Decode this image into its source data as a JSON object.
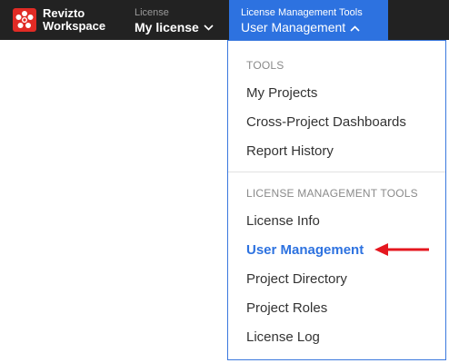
{
  "brand": {
    "line1": "Revizto",
    "line2": "Workspace"
  },
  "license_switcher": {
    "label": "License",
    "value": "My license"
  },
  "tools_tab": {
    "label": "License Management Tools",
    "value": "User Management"
  },
  "dropdown": {
    "sections": [
      {
        "title": "TOOLS",
        "items": [
          "My Projects",
          "Cross-Project Dashboards",
          "Report History"
        ]
      },
      {
        "title": "LICENSE MANAGEMENT TOOLS",
        "items": [
          "License Info",
          "User Management",
          "Project Directory",
          "Project Roles",
          "License Log"
        ]
      }
    ],
    "active_item": "User Management"
  },
  "colors": {
    "topbar": "#222222",
    "accent": "#2d72e0",
    "logo": "#e12b25",
    "annotation_arrow": "#e5171f"
  },
  "icons": {
    "logo": "revizto-logo-icon",
    "chevron_down": "chevron-down-icon",
    "chevron_up": "chevron-up-icon",
    "annotation": "red-arrow-icon"
  }
}
